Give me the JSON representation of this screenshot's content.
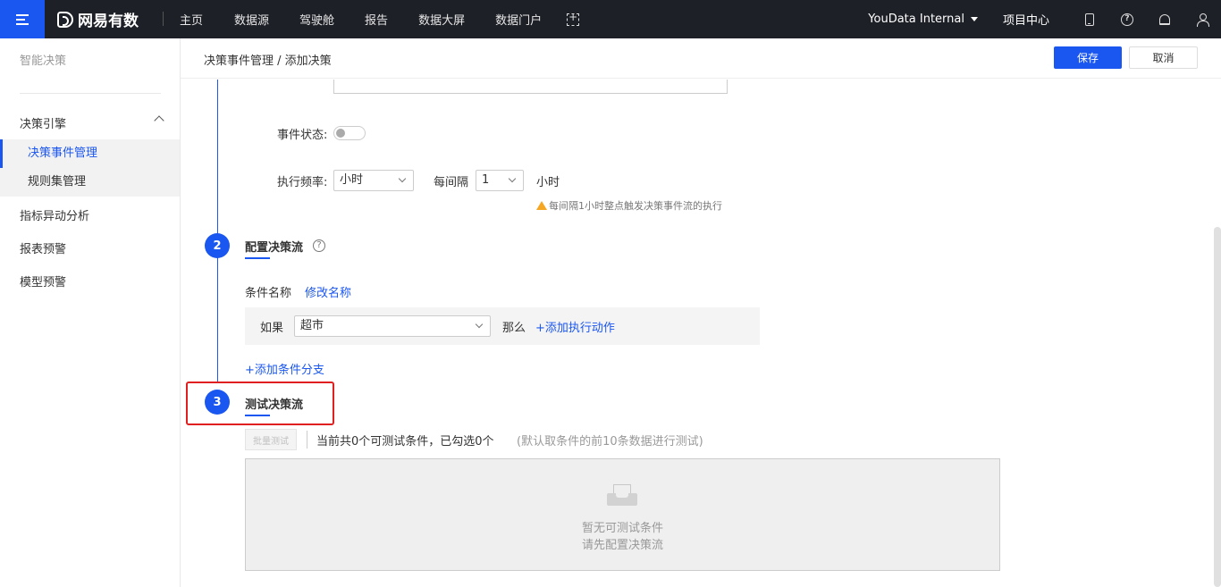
{
  "topbar": {
    "brand": "网易有数",
    "nav": [
      "主页",
      "数据源",
      "驾驶舱",
      "报告",
      "数据大屏",
      "数据门户"
    ],
    "tenant": "YouData Internal",
    "project_center": "项目中心"
  },
  "sidebar": {
    "title": "智能决策",
    "group": "决策引擎",
    "sub_items": [
      "决策事件管理",
      "规则集管理"
    ],
    "items": [
      "指标异动分析",
      "报表预警",
      "模型预警"
    ]
  },
  "header": {
    "breadcrumb": "决策事件管理 / 添加决策",
    "save_label": "保存",
    "cancel_label": "取消"
  },
  "form": {
    "status_label": "事件状态:",
    "frequency_label": "执行频率:",
    "frequency_value": "小时",
    "interval_label": "每间隔",
    "interval_value": "1",
    "interval_unit": "小时",
    "hint": "每间隔1小时整点触发决策事件流的执行"
  },
  "step2": {
    "number": "2",
    "title": "配置决策流",
    "condition_name_label": "条件名称",
    "rename_link": "修改名称",
    "if_label": "如果",
    "if_value": "超市",
    "then_label": "那么",
    "add_action_link": "+添加执行动作",
    "add_branch_link": "+添加条件分支"
  },
  "step3": {
    "number": "3",
    "title": "测试决策流",
    "batch_test_label": "批量测试",
    "count_text": "当前共0个可测试条件，已勾选0个",
    "note_text": "(默认取条件的前10条数据进行测试)",
    "empty_line1": "暂无可测试条件",
    "empty_line2": "请先配置决策流"
  }
}
